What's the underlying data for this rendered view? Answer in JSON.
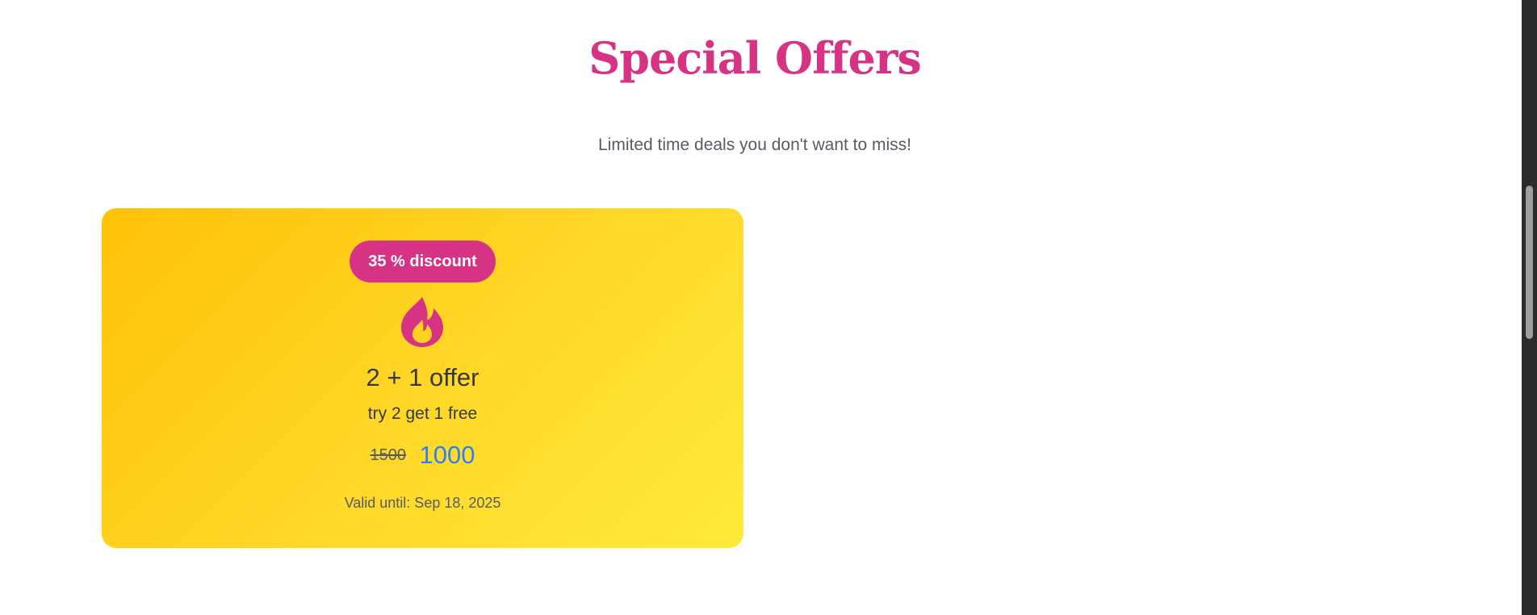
{
  "section": {
    "title": "Special Offers",
    "subtitle": "Limited time deals you don't want to miss!"
  },
  "offer": {
    "badge": "35 % discount",
    "icon": "fire-icon",
    "title": "2 + 1 offer",
    "description": "try 2 get 1 free",
    "old_price": "1500",
    "new_price": "1000",
    "valid_until": "Valid until: Sep 18, 2025"
  },
  "colors": {
    "accent": "#d63384",
    "card_gradient_start": "#ffc107",
    "card_gradient_end": "#ffeb3b",
    "price": "#2f80ed",
    "text": "#343a40"
  }
}
